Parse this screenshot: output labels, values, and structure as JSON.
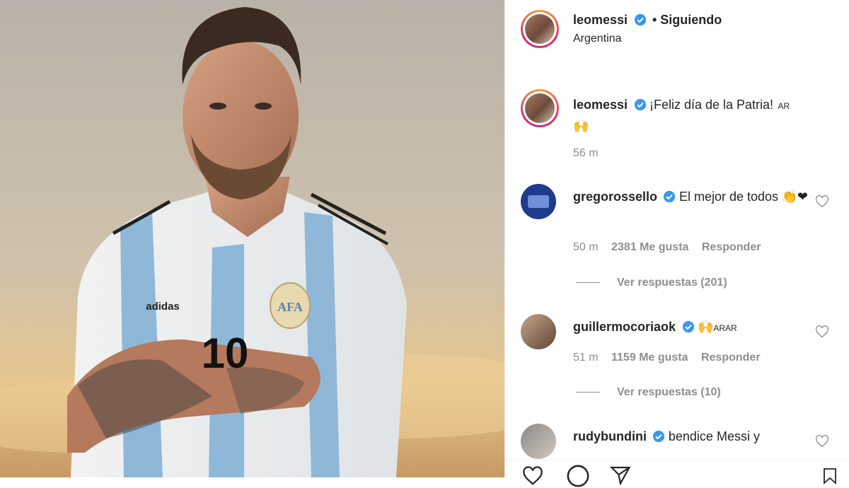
{
  "post": {
    "username": "leomessi",
    "follow_status": "• Siguiendo",
    "location": "Argentina"
  },
  "caption": {
    "username": "leomessi",
    "text": "¡Feliz día de la Patria!",
    "flag": "AR",
    "emoji": "🙌",
    "time": "56 m"
  },
  "comments": [
    {
      "username": "gregorossello",
      "text": "El mejor de todos",
      "emoji": "👏❤",
      "time": "50 m",
      "likes": "2381 Me gusta",
      "reply": "Responder",
      "view_replies": "Ver respuestas (201)"
    },
    {
      "username": "guillermocoriaok",
      "emoji": "🙌",
      "flags": "ARAR",
      "time": "51 m",
      "likes": "1159 Me gusta",
      "reply": "Responder",
      "view_replies": "Ver respuestas (10)"
    },
    {
      "username": "rudybundini",
      "text": "bendice Messi y"
    }
  ],
  "photo_jersey": {
    "number": "10",
    "brand": "adidas",
    "badge": "AFA"
  },
  "colors": {
    "verified": "#3897f0",
    "heart": "#ed4956",
    "muted": "#8e8e8e"
  }
}
